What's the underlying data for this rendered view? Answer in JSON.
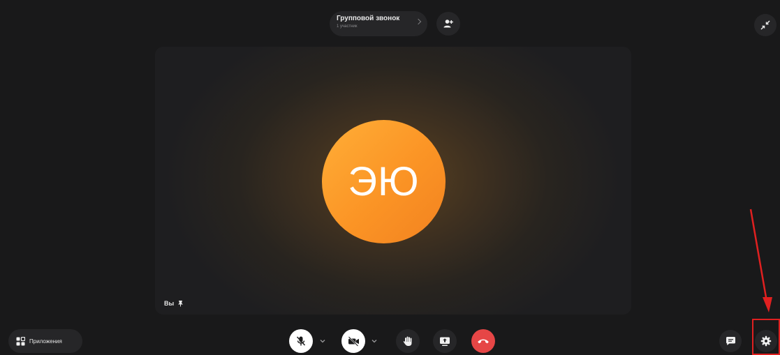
{
  "header": {
    "title": "Групповой звонок",
    "subtitle": "1 участник"
  },
  "tile": {
    "initials": "ЭЮ",
    "self_label": "Вы"
  },
  "bottom_bar": {
    "apps_label": "Приложения"
  },
  "colors": {
    "background": "#19191a",
    "avatar_orange": "#fb9425",
    "end_call_red": "#e64646",
    "annotation_red": "#e02020"
  },
  "icons": [
    "add-user-icon",
    "minimize-icon",
    "apps-icon",
    "mic-off-icon",
    "camera-off-icon",
    "raise-hand-icon",
    "screen-share-icon",
    "end-call-icon",
    "chat-icon",
    "settings-icon",
    "pin-icon"
  ]
}
